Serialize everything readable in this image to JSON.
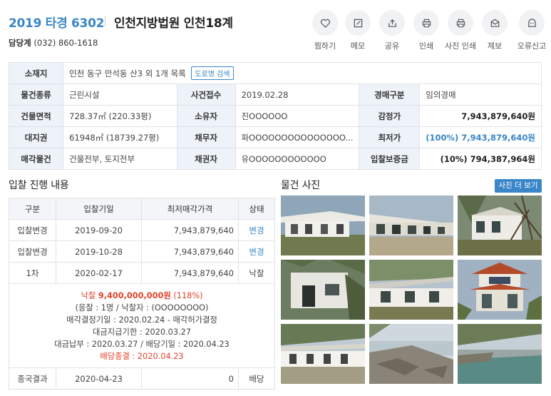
{
  "header": {
    "case_no": "2019 타경 6302",
    "court": "인천지방법원 인천18계",
    "dept_label": "담당계",
    "dept_phone": "(032) 860-1618"
  },
  "actions": [
    {
      "label": "찜하기",
      "icon": "heart-icon"
    },
    {
      "label": "메모",
      "icon": "memo-icon"
    },
    {
      "label": "공유",
      "icon": "share-icon"
    },
    {
      "label": "인쇄",
      "icon": "print-icon"
    },
    {
      "label": "사진 인쇄",
      "icon": "photo-print-icon"
    },
    {
      "label": "제보",
      "icon": "report-icon"
    },
    {
      "label": "오류신고",
      "icon": "error-report-icon"
    }
  ],
  "info": {
    "location_label": "소재지",
    "location_value": "인천 동구 만석동 산3 외 1개 목록",
    "road_search": "도로명 검색",
    "rows": [
      {
        "k1": "물건종류",
        "v1": "근린시설",
        "k2": "사건접수",
        "v2": "2019.02.28",
        "k3": "경매구분",
        "v3": "임의경매"
      },
      {
        "k1": "건물면적",
        "v1": "728.37㎡ (220.33평)",
        "k2": "소유자",
        "v2": "진OOOOOO",
        "k3": "감정가",
        "v3": "7,943,879,640원"
      },
      {
        "k1": "대지권",
        "v1": "61948㎡ (18739.27평)",
        "k2": "채무자",
        "v2": "파OOOOOOOOOOOOOOO...",
        "k3": "최저가",
        "v3": "(100%) 7,943,879,640원"
      },
      {
        "k1": "매각물건",
        "v1": "건물전부, 토지전부",
        "k2": "채권자",
        "v2": "유OOOOOOOOOOOO",
        "k3": "입찰보증금",
        "v3": "(10%) 794,387,964원"
      }
    ]
  },
  "bidding": {
    "title": "입찰 진행 내용",
    "columns": [
      "구분",
      "입찰기일",
      "최저매각가격",
      "상태"
    ],
    "rows": [
      {
        "type": "입찰변경",
        "date": "2019-09-20",
        "price": "7,943,879,640",
        "status": "변경"
      },
      {
        "type": "입찰변경",
        "date": "2019-10-28",
        "price": "7,943,879,640",
        "status": "변경"
      },
      {
        "type": "1차",
        "date": "2020-02-17",
        "price": "7,943,879,640",
        "status": "낙찰"
      }
    ],
    "detail": {
      "sold_label": "낙찰",
      "sold_price": "9,400,000,000원",
      "sold_rate": "(118%)",
      "bidders": "(응찰 : 1명 / 낙찰자 : (OOOOOOOO)",
      "decision": "매각결정기일 : 2020.02.24 - 매각허가결정",
      "deadline": "대금지급기한 : 2020.03.27",
      "payment": "대금납부 : 2020.03.27 / 배당기일 : 2020.04.23",
      "closed": "배당종결 : 2020.04.23"
    },
    "final": {
      "type": "종국결과",
      "date": "2020-04-23",
      "price": "0",
      "status": "배당"
    }
  },
  "photos": {
    "title": "물건 사진",
    "more": "사진 더 보기"
  },
  "colors": {
    "accent": "#3a86c8",
    "red": "#e2432a",
    "label_bg": "#eef3f9"
  }
}
